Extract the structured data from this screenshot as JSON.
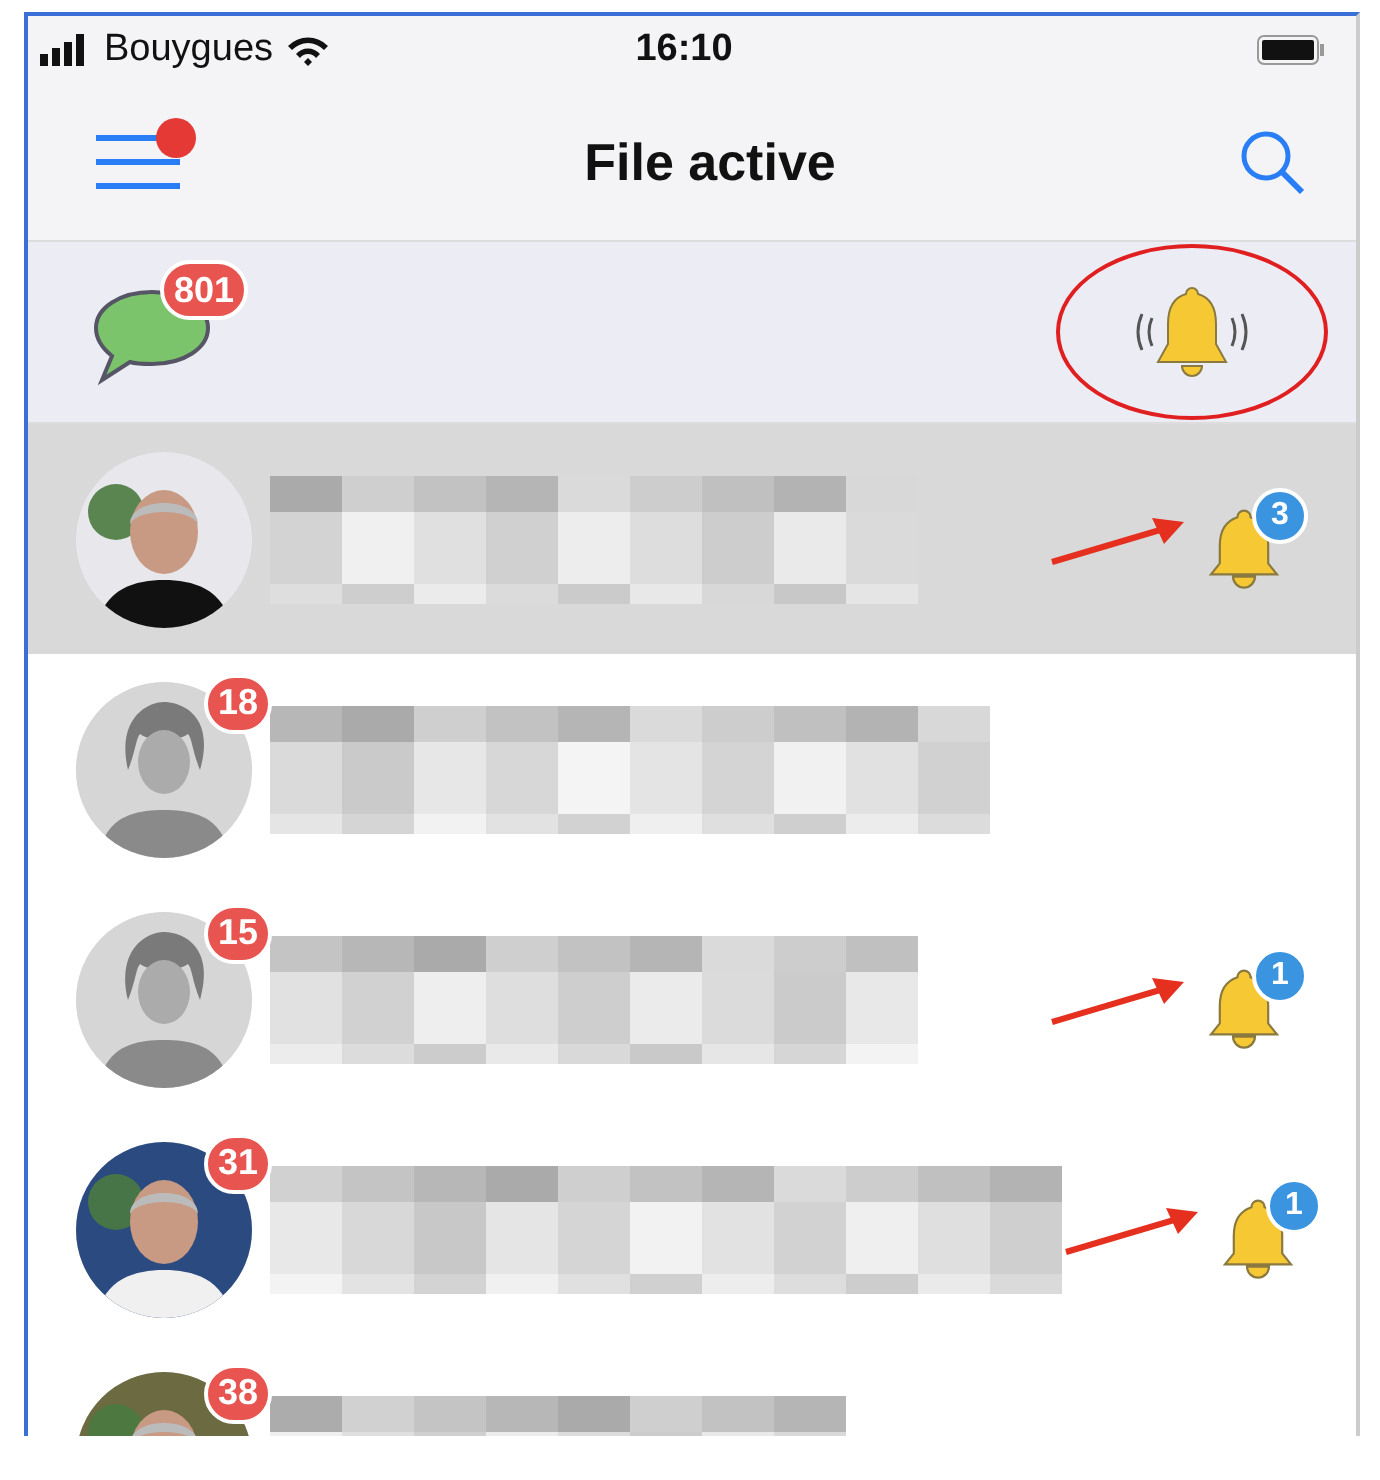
{
  "status_bar": {
    "carrier": "Bouygues",
    "time": "16:10"
  },
  "nav": {
    "title": "File active",
    "menu_has_notification": true
  },
  "banner": {
    "messages_badge": "801",
    "bell_annotated": true
  },
  "rows": [
    {
      "selected": true,
      "bell_count": "3"
    },
    {
      "kind": "placeholder",
      "selected": false,
      "badge": "18"
    },
    {
      "kind": "placeholder",
      "selected": false,
      "badge": "15",
      "bell_count": "1"
    },
    {
      "selected": false,
      "badge": "31",
      "bell_count": "1"
    },
    {
      "selected": false,
      "badge": "38"
    }
  ]
}
